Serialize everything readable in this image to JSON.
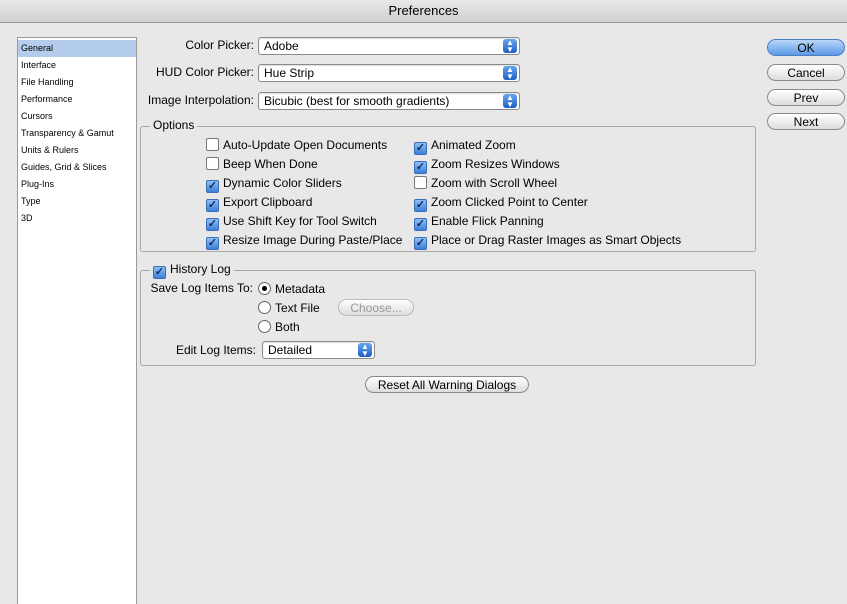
{
  "window": {
    "title": "Preferences"
  },
  "sidebar": {
    "items": [
      {
        "label": "General",
        "selected": true
      },
      {
        "label": "Interface"
      },
      {
        "label": "File Handling"
      },
      {
        "label": "Performance"
      },
      {
        "label": "Cursors"
      },
      {
        "label": "Transparency & Gamut"
      },
      {
        "label": "Units & Rulers"
      },
      {
        "label": "Guides, Grid & Slices"
      },
      {
        "label": "Plug-Ins"
      },
      {
        "label": "Type"
      },
      {
        "label": "3D"
      }
    ]
  },
  "fields": {
    "color_picker": {
      "label": "Color Picker:",
      "value": "Adobe"
    },
    "hud_color_picker": {
      "label": "HUD Color Picker:",
      "value": "Hue Strip"
    },
    "image_interpolation": {
      "label": "Image Interpolation:",
      "value": "Bicubic (best for smooth gradients)"
    }
  },
  "options": {
    "legend": "Options",
    "left": [
      {
        "label": "Auto-Update Open Documents",
        "checked": false
      },
      {
        "label": "Beep When Done",
        "checked": false
      },
      {
        "label": "Dynamic Color Sliders",
        "checked": true
      },
      {
        "label": "Export Clipboard",
        "checked": true
      },
      {
        "label": "Use Shift Key for Tool Switch",
        "checked": true
      },
      {
        "label": "Resize Image During Paste/Place",
        "checked": true
      }
    ],
    "right": [
      {
        "label": "Animated Zoom",
        "checked": true
      },
      {
        "label": "Zoom Resizes Windows",
        "checked": true
      },
      {
        "label": "Zoom with Scroll Wheel",
        "checked": false
      },
      {
        "label": "Zoom Clicked Point to Center",
        "checked": true
      },
      {
        "label": "Enable Flick Panning",
        "checked": true
      },
      {
        "label": "Place or Drag Raster Images as Smart Objects",
        "checked": true
      }
    ]
  },
  "history": {
    "legend": "History Log",
    "enabled": true,
    "save_to_label": "Save Log Items To:",
    "radios": [
      {
        "label": "Metadata",
        "selected": true
      },
      {
        "label": "Text File",
        "selected": false
      },
      {
        "label": "Both",
        "selected": false
      }
    ],
    "choose_label": "Choose...",
    "edit_label": "Edit Log Items:",
    "edit_value": "Detailed"
  },
  "reset_label": "Reset All Warning Dialogs",
  "buttons": {
    "ok": "OK",
    "cancel": "Cancel",
    "prev": "Prev",
    "next": "Next"
  }
}
